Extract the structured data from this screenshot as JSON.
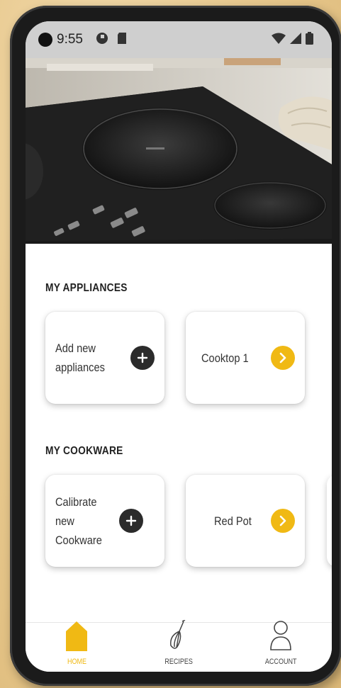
{
  "status_bar": {
    "time": "9:55",
    "left_icons": [
      "app-notification-icon",
      "sd-card-icon"
    ],
    "right_icons": [
      "wifi-icon",
      "cell-signal-icon",
      "battery-icon"
    ]
  },
  "hero": {
    "icon": "cooktop-photo"
  },
  "appliances": {
    "title": "MY APPLIANCES",
    "add_label": "Add new appliances",
    "add_icon": "plus-icon",
    "items": [
      {
        "label": "Cooktop 1",
        "icon": "chevron-right-icon"
      }
    ]
  },
  "cookware": {
    "title": "MY COOKWARE",
    "add_label": "Calibrate new Cookware",
    "add_icon": "plus-icon",
    "items": [
      {
        "label": "Red Pot",
        "icon": "chevron-right-icon"
      }
    ]
  },
  "bottom_nav": {
    "items": [
      {
        "label": "HOME",
        "icon": "home-icon",
        "active": true
      },
      {
        "label": "RECIPES",
        "icon": "whisk-icon",
        "active": false
      },
      {
        "label": "ACCOUNT",
        "icon": "person-icon",
        "active": false
      }
    ]
  },
  "colors": {
    "accent": "#f0b914",
    "dark_button": "#2b2b2b",
    "status_bar": "#cfcfcf",
    "background": "#e8c98f"
  }
}
